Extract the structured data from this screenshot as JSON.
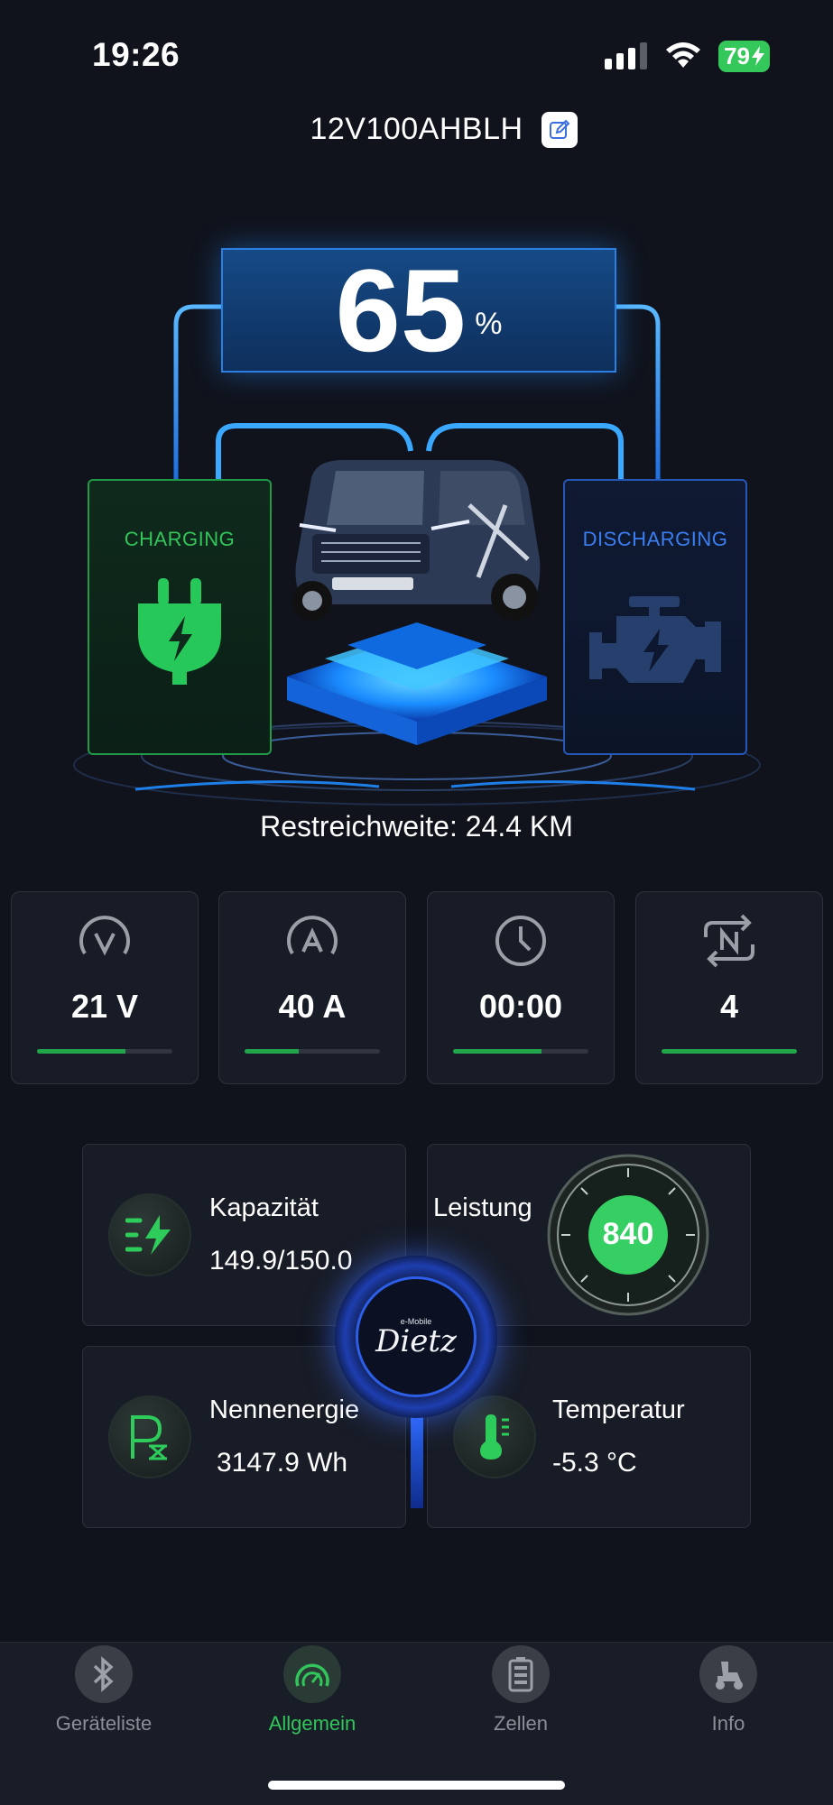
{
  "status_bar": {
    "time": "19:26",
    "battery": "79"
  },
  "header": {
    "device_name": "12V100AHBLH"
  },
  "hero": {
    "soc_value": "65",
    "soc_unit": "%",
    "charging_label": "CHARGING",
    "discharging_label": "DISCHARGING",
    "range_text": "Restreichweite: 24.4 KM"
  },
  "stats": [
    {
      "icon": "voltage-icon",
      "value": "21 V",
      "bar": 0.65
    },
    {
      "icon": "current-icon",
      "value": "40 A",
      "bar": 0.4
    },
    {
      "icon": "clock-icon",
      "value": "00:00",
      "bar": 0.65
    },
    {
      "icon": "cycles-icon",
      "value": "4",
      "bar": 1.0
    }
  ],
  "cards": {
    "capacity": {
      "title": "Kapazität",
      "value": "149.9/150.0"
    },
    "power": {
      "title": "Leistung",
      "value": "840"
    },
    "energy": {
      "title": "Nennenergie",
      "value": "3147.9 Wh"
    },
    "temperature": {
      "title": "Temperatur",
      "value": "-5.3 °C"
    }
  },
  "logo": {
    "small_text": "e-Mobile",
    "brand": "Dietz"
  },
  "tabs": [
    {
      "label": "Geräteliste",
      "icon": "bluetooth-icon",
      "active": false
    },
    {
      "label": "Allgemein",
      "icon": "gauge-icon",
      "active": true
    },
    {
      "label": "Zellen",
      "icon": "battery-cells-icon",
      "active": false
    },
    {
      "label": "Info",
      "icon": "scooter-icon",
      "active": false
    }
  ],
  "colors": {
    "accent_green": "#31c55b",
    "accent_blue": "#2a7fe0",
    "background": "#10131c"
  }
}
